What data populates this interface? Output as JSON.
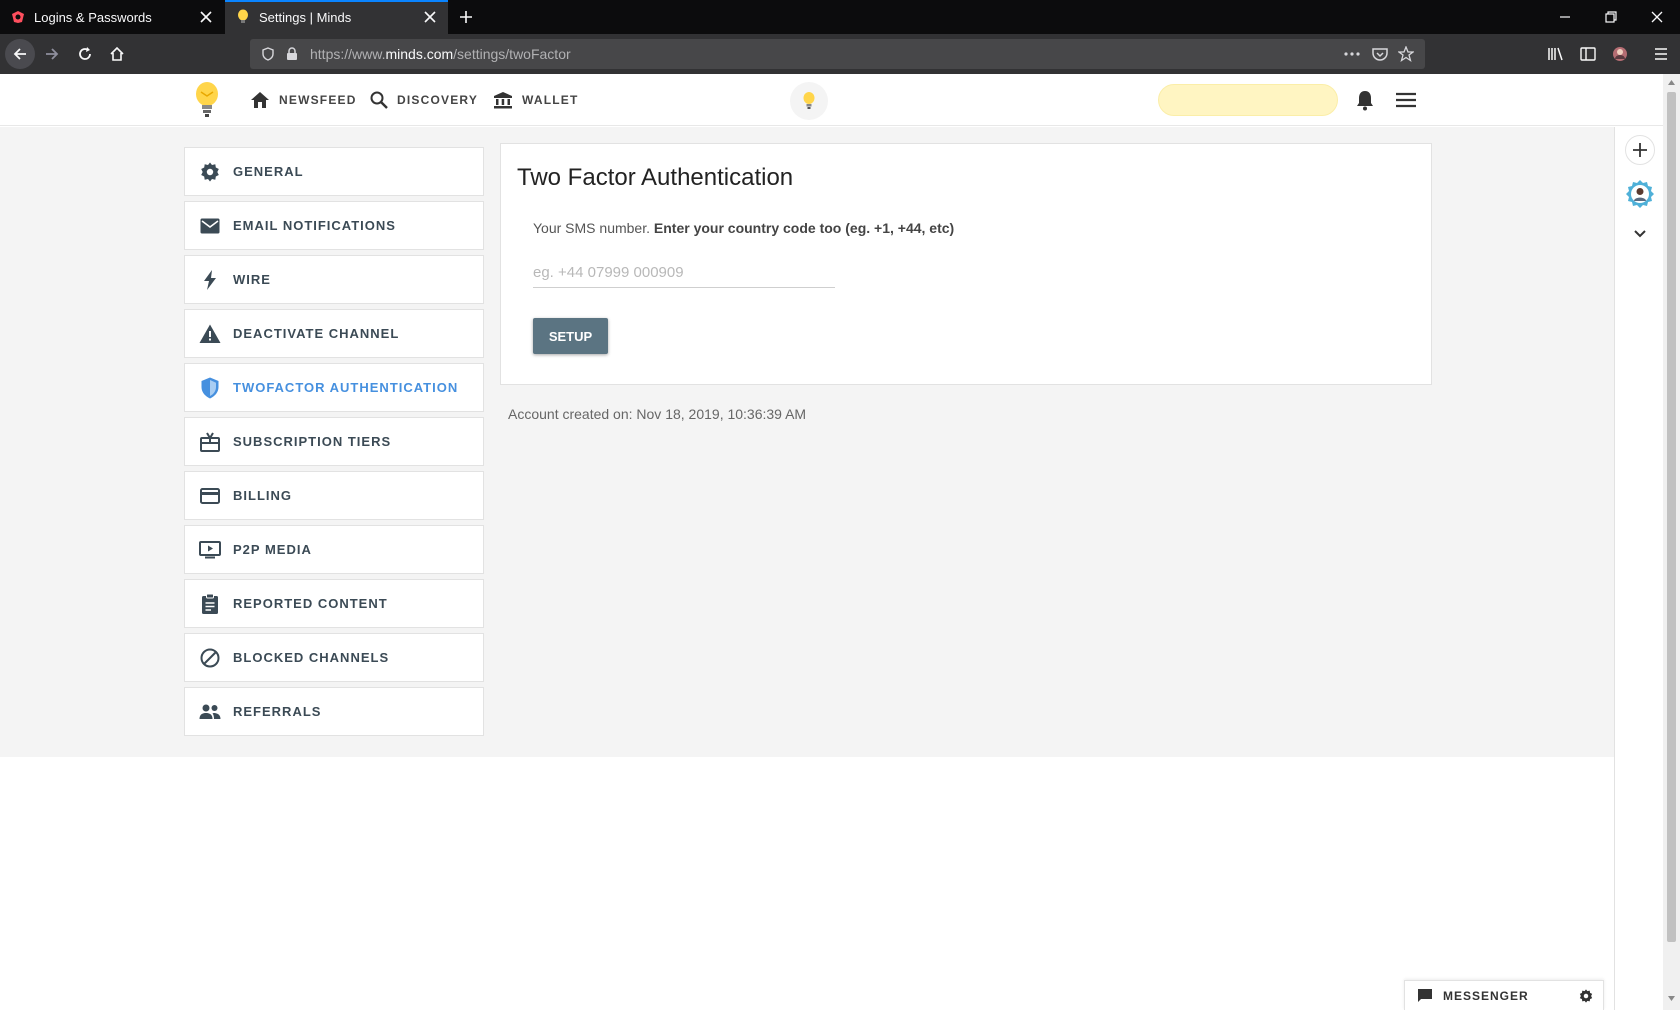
{
  "browser": {
    "tabs": [
      {
        "title": "Logins & Passwords",
        "active": false
      },
      {
        "title": "Settings | Minds",
        "active": true
      }
    ],
    "url": {
      "prefix": "https://www.",
      "domain": "minds.com",
      "path": "/settings/twoFactor"
    }
  },
  "topnav": {
    "newsfeed": "NEWSFEED",
    "discovery": "DISCOVERY",
    "wallet": "WALLET"
  },
  "sidebar": {
    "items": [
      {
        "label": "GENERAL",
        "icon": "gear-icon"
      },
      {
        "label": "EMAIL NOTIFICATIONS",
        "icon": "mail-icon"
      },
      {
        "label": "WIRE",
        "icon": "bolt-icon"
      },
      {
        "label": "DEACTIVATE CHANNEL",
        "icon": "warning-icon"
      },
      {
        "label": "TWOFACTOR AUTHENTICATION",
        "icon": "shield-icon",
        "active": true
      },
      {
        "label": "SUBSCRIPTION TIERS",
        "icon": "gift-icon"
      },
      {
        "label": "BILLING",
        "icon": "credit-card-icon"
      },
      {
        "label": "P2P MEDIA",
        "icon": "video-icon"
      },
      {
        "label": "REPORTED CONTENT",
        "icon": "clipboard-icon"
      },
      {
        "label": "BLOCKED CHANNELS",
        "icon": "block-icon"
      },
      {
        "label": "REFERRALS",
        "icon": "people-icon"
      }
    ]
  },
  "twofactor": {
    "title": "Two Factor Authentication",
    "sms_label": "Your SMS number.",
    "sms_hint": "Enter your country code too (eg. +1, +44, etc)",
    "phone_placeholder": "eg. +44 07999 000909",
    "phone_value": "",
    "setup_label": "SETUP"
  },
  "account_created": "Account created on: Nov 18, 2019, 10:36:39 AM",
  "messenger": {
    "label": "MESSENGER"
  },
  "colors": {
    "accent_blue": "#4690df",
    "button": "#5b7482",
    "search_bg": "#fff5c2",
    "page_bg": "#f4f4f4"
  }
}
